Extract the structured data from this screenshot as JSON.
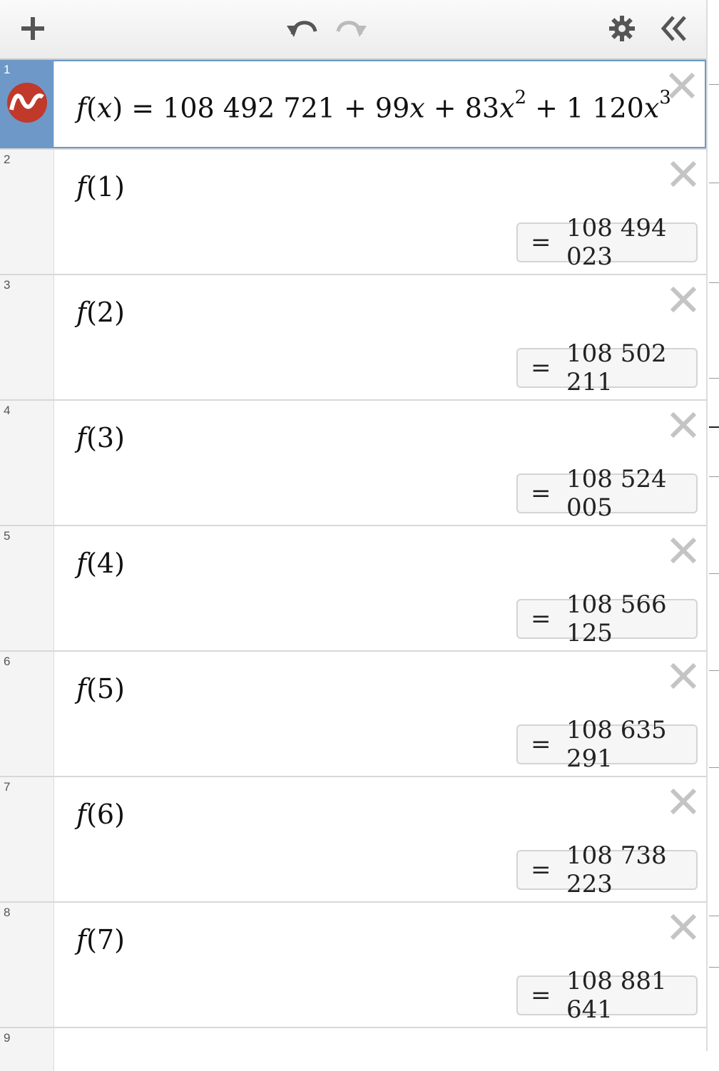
{
  "toolbar": {
    "add_icon": "plus-icon",
    "undo_icon": "undo-icon",
    "redo_icon": "redo-icon",
    "settings_icon": "gear-icon",
    "collapse_icon": "double-chevron-left-icon"
  },
  "expressions": [
    {
      "num": "1",
      "func": "f",
      "arg": "x",
      "rhs_prefix": "108 492 721 + 99",
      "v1": "x",
      "mid": " + 83",
      "v2": "x",
      "p2": "2",
      "mid2": " + 1 120",
      "v3": "x",
      "p3": "3"
    },
    {
      "num": "2",
      "call": "f",
      "arg": "1",
      "result": "108 494 023"
    },
    {
      "num": "3",
      "call": "f",
      "arg": "2",
      "result": "108 502 211"
    },
    {
      "num": "4",
      "call": "f",
      "arg": "3",
      "result": "108 524 005"
    },
    {
      "num": "5",
      "call": "f",
      "arg": "4",
      "result": "108 566 125"
    },
    {
      "num": "6",
      "call": "f",
      "arg": "5",
      "result": "108 635 291"
    },
    {
      "num": "7",
      "call": "f",
      "arg": "6",
      "result": "108 738 223"
    },
    {
      "num": "8",
      "call": "f",
      "arg": "7",
      "result": "108 881 641"
    },
    {
      "num": "9"
    }
  ],
  "equals_sign": "=",
  "colors": {
    "accent": "#6e98c8",
    "logo_red": "#c0392b"
  }
}
